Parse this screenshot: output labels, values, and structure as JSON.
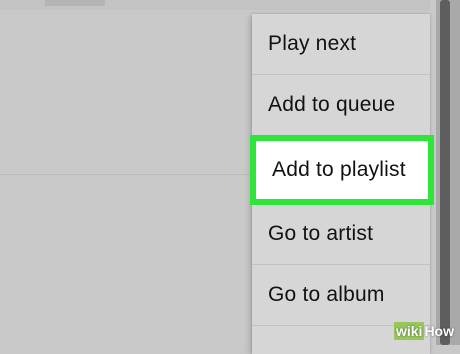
{
  "menu": {
    "items": [
      {
        "label": "Play next",
        "highlighted": false
      },
      {
        "label": "Add to queue",
        "highlighted": false
      },
      {
        "label": "Add to playlist",
        "highlighted": true
      },
      {
        "label": "Go to artist",
        "highlighted": false
      },
      {
        "label": "Go to album",
        "highlighted": false
      }
    ]
  },
  "watermark": {
    "part1": "wiki",
    "part2": "How"
  },
  "colors": {
    "highlight_border": "#2fe43a",
    "background": "#c9c9c9",
    "menu_background": "#d6d6d6"
  }
}
